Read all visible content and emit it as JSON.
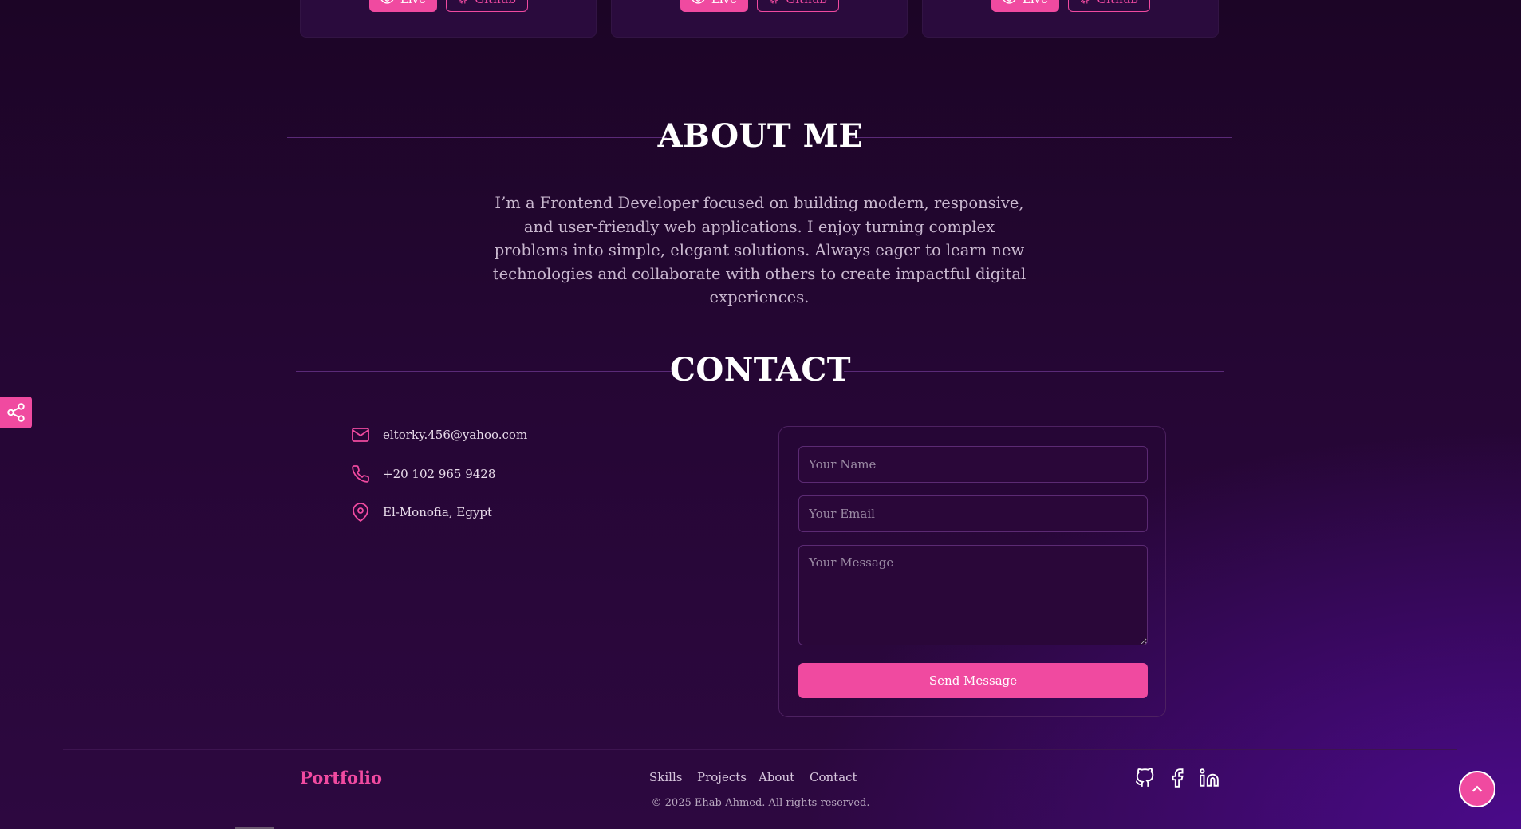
{
  "projects": [
    {
      "live_label": "Live",
      "github_label": "Github"
    },
    {
      "live_label": "Live",
      "github_label": "Github"
    },
    {
      "live_label": "Live",
      "github_label": "Github"
    }
  ],
  "about": {
    "title": "ABOUT ME",
    "text": "I’m a Frontend Developer focused on building modern, responsive, and user-friendly web applications. I enjoy turning complex problems into simple, elegant solutions. Always eager to learn new technologies and collaborate with others to create impactful digital experiences."
  },
  "contact": {
    "title": "CONTACT",
    "email": "eltorky.456@yahoo.com",
    "phone": "+20 102 965 9428",
    "location": "El-Monofia, Egypt",
    "form": {
      "name_placeholder": "Your Name",
      "email_placeholder": "Your Email",
      "message_placeholder": "Your Message",
      "send_label": "Send Message"
    }
  },
  "footer": {
    "brand": "Portfolio",
    "nav": [
      "Skills",
      "Projects",
      "About",
      "Contact"
    ],
    "copyright": "© 2025 Ehab-Ahmed. All rights reserved.",
    "social_icons": [
      "github-icon",
      "facebook-icon",
      "linkedin-icon"
    ]
  },
  "colors": {
    "accent": "#f04aa0",
    "background": "#250634"
  }
}
